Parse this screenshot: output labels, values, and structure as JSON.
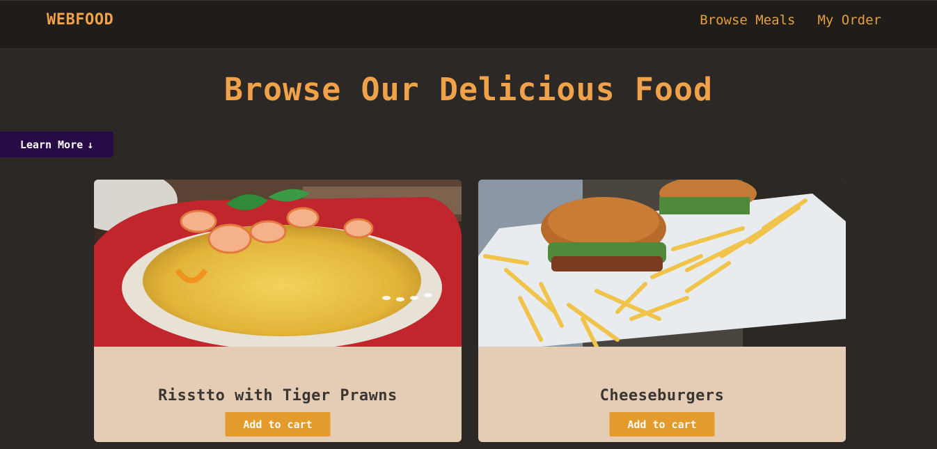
{
  "header": {
    "brand": "WEBFOOD",
    "nav": [
      "Browse Meals",
      "My Order"
    ]
  },
  "hero": {
    "title": "Browse Our Delicious Food",
    "learn_more_label": "Learn More",
    "learn_more_icon": "arrow-down-icon"
  },
  "meals": [
    {
      "name": "Risstto with Tiger Prawns",
      "button_label": "Add to cart"
    },
    {
      "name": "Cheeseburgers",
      "button_label": "Add to cart"
    }
  ],
  "colors": {
    "background": "#2b2826",
    "topbar": "#1f1c1a",
    "accent": "#f0a24b",
    "card": "#e4cdb4",
    "button": "#e39b2d",
    "learn_more_bg": "#270a46"
  }
}
